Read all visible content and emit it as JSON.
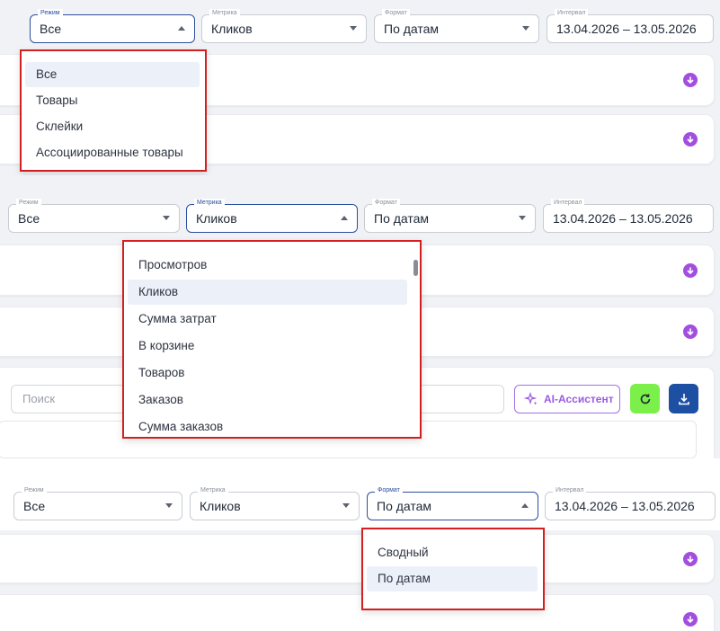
{
  "labels": {
    "mode": "Режим",
    "metric": "Метрика",
    "format": "Формат",
    "interval": "Интервал"
  },
  "values": {
    "mode": "Все",
    "metric": "Кликов",
    "format": "По датам",
    "interval": "13.04.2026 – 13.05.2026"
  },
  "mode_options": [
    "Все",
    "Товары",
    "Склейки",
    "Ассоциированные товары"
  ],
  "metric_options": [
    "Просмотров",
    "Кликов",
    "Сумма затрат",
    "В корзине",
    "Товаров",
    "Заказов",
    "Сумма заказов"
  ],
  "format_options": [
    "Сводный",
    "По датам"
  ],
  "search_placeholder": "Поиск",
  "ai_button_label": "AI-Ассистент",
  "colors": {
    "accent": "#2b4e9c",
    "highlight_border": "#d21f1f",
    "arrow_badge": "#a24fe0",
    "refresh_button": "#7cf04a",
    "download_button": "#1d4fa3"
  },
  "icons": {
    "expand": "arrow-down-circle-icon",
    "ai": "sparkle-icon",
    "refresh": "refresh-icon",
    "download": "download-icon"
  }
}
